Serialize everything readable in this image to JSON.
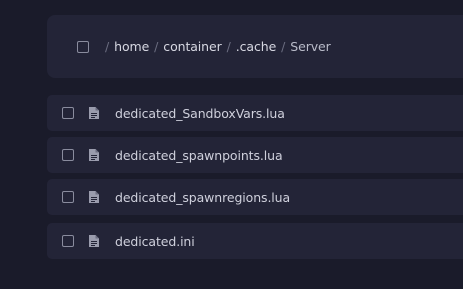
{
  "breadcrumb": {
    "separator": "/",
    "segments": [
      "home",
      "container",
      ".cache",
      "Server"
    ]
  },
  "files": [
    {
      "name": "dedicated_SandboxVars.lua",
      "icon": "file-icon"
    },
    {
      "name": "dedicated_spawnpoints.lua",
      "icon": "file-icon"
    },
    {
      "name": "dedicated_spawnregions.lua",
      "icon": "file-icon"
    },
    {
      "name": "dedicated.ini",
      "icon": "file-icon"
    }
  ],
  "colors": {
    "background": "#1a1b2a",
    "panel": "#232437",
    "text": "#cfd0dc",
    "muted": "#6b6d80"
  }
}
